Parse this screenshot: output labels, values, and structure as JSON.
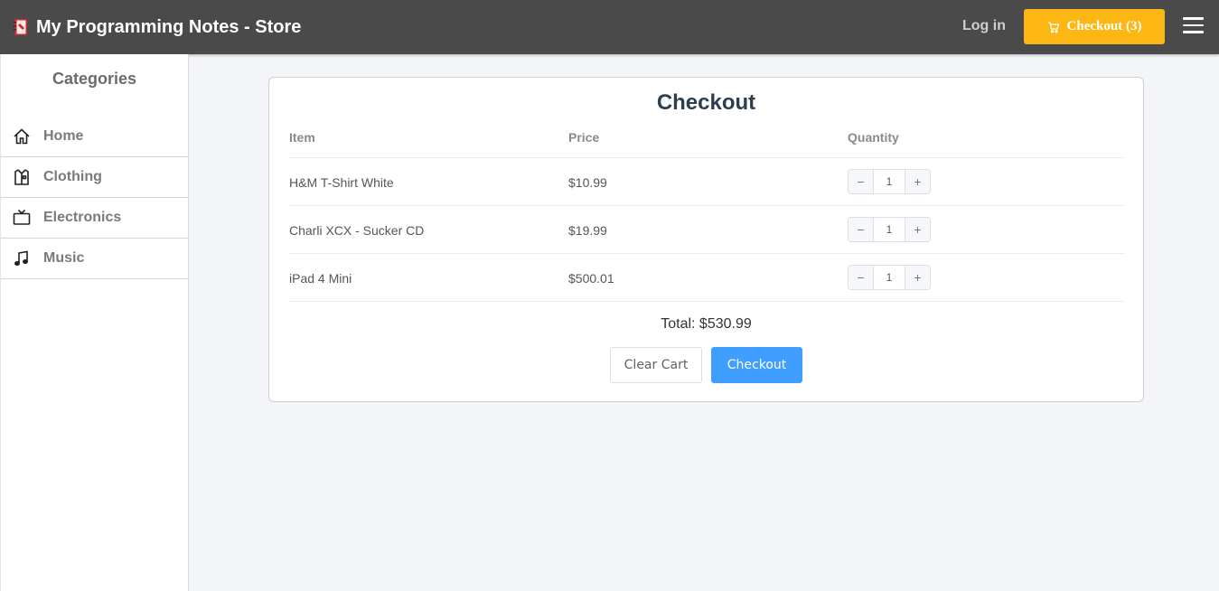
{
  "header": {
    "title": "My Programming Notes - Store",
    "login_label": "Log in",
    "checkout_label": "Checkout (3)",
    "accent_color": "#fdb714",
    "bg_color": "#4a4a4a"
  },
  "sidebar": {
    "title": "Categories",
    "items": [
      {
        "label": "Home",
        "icon": "home-icon"
      },
      {
        "label": "Clothing",
        "icon": "shirt-icon"
      },
      {
        "label": "Electronics",
        "icon": "tv-icon"
      },
      {
        "label": "Music",
        "icon": "music-note-icon"
      }
    ]
  },
  "checkout": {
    "title": "Checkout",
    "columns": [
      "Item",
      "Price",
      "Quantity"
    ],
    "rows": [
      {
        "item": "H&M T-Shirt White",
        "price": "$10.99",
        "quantity": "1"
      },
      {
        "item": "Charli XCX - Sucker CD",
        "price": "$19.99",
        "quantity": "1"
      },
      {
        "item": "iPad 4 Mini",
        "price": "$500.01",
        "quantity": "1"
      }
    ],
    "total": "Total: $530.99",
    "clear_label": "Clear Cart",
    "checkout_label": "Checkout",
    "primary_color": "#409eff"
  }
}
